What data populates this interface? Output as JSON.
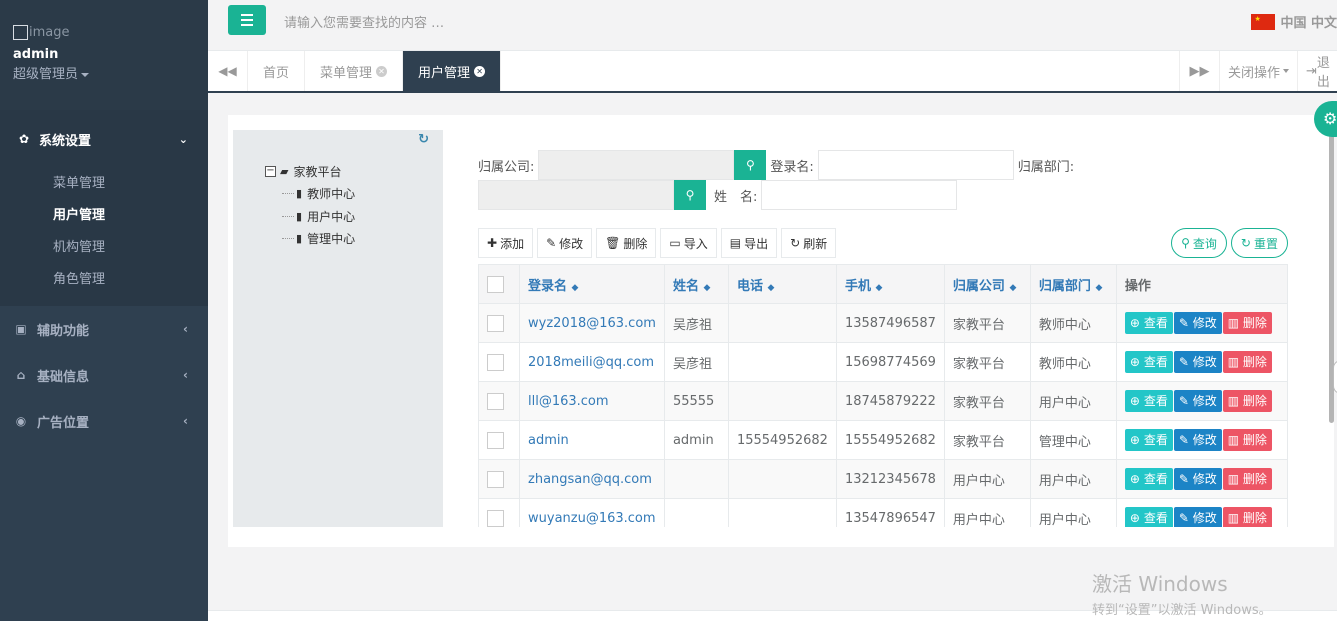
{
  "sidebar": {
    "avatar_alt": "image",
    "username": "admin",
    "role": "超级管理员",
    "groups": [
      {
        "label": "系统设置",
        "expanded": true,
        "items": [
          {
            "label": "菜单管理",
            "active": false
          },
          {
            "label": "用户管理",
            "active": true
          },
          {
            "label": "机构管理",
            "active": false
          },
          {
            "label": "角色管理",
            "active": false
          }
        ]
      },
      {
        "label": "辅助功能",
        "expanded": false
      },
      {
        "label": "基础信息",
        "expanded": false
      },
      {
        "label": "广告位置",
        "expanded": false
      }
    ]
  },
  "topbar": {
    "search_placeholder": "请输入您需要查找的内容 …",
    "language": "中国 中文"
  },
  "tabs": {
    "items": [
      {
        "label": "首页",
        "closable": false,
        "active": false
      },
      {
        "label": "菜单管理",
        "closable": true,
        "active": false
      },
      {
        "label": "用户管理",
        "closable": true,
        "active": true
      }
    ],
    "close_ops": "关闭操作",
    "logout": "退出"
  },
  "tree": {
    "root": "家教平台",
    "children": [
      "教师中心",
      "用户中心",
      "管理中心"
    ]
  },
  "filter": {
    "company_label": "归属公司:",
    "login_label": "登录名:",
    "dept_label": "归属部门:",
    "name_label": "姓　名:"
  },
  "toolbar": {
    "add": "添加",
    "edit": "修改",
    "delete": "删除",
    "import": "导入",
    "export": "导出",
    "refresh": "刷新",
    "query": "查询",
    "reset": "重置"
  },
  "table": {
    "headers": [
      "登录名",
      "姓名",
      "电话",
      "手机",
      "归属公司",
      "归属部门",
      "操作"
    ],
    "action_labels": {
      "view": "查看",
      "edit": "修改",
      "delete": "删除"
    },
    "rows": [
      {
        "login": "wyz2018@163.com",
        "name": "吴彦祖",
        "phone": "",
        "mobile": "13587496587",
        "company": "家教平台",
        "dept": "教师中心"
      },
      {
        "login": "2018meili@qq.com",
        "name": "吴彦祖",
        "phone": "",
        "mobile": "15698774569",
        "company": "家教平台",
        "dept": "教师中心"
      },
      {
        "login": "lll@163.com",
        "name": "55555",
        "phone": "",
        "mobile": "18745879222",
        "company": "家教平台",
        "dept": "用户中心"
      },
      {
        "login": "admin",
        "name": "admin",
        "phone": "15554952682",
        "mobile": "15554952682",
        "company": "家教平台",
        "dept": "管理中心"
      },
      {
        "login": "zhangsan@qq.com",
        "name": "",
        "phone": "",
        "mobile": "13212345678",
        "company": "用户中心",
        "dept": "用户中心"
      },
      {
        "login": "wuyanzu@163.com",
        "name": "",
        "phone": "",
        "mobile": "13547896547",
        "company": "用户中心",
        "dept": "用户中心"
      }
    ]
  },
  "watermark": {
    "line1": "激活 Windows",
    "line2": "转到“设置”以激活 Windows。"
  }
}
